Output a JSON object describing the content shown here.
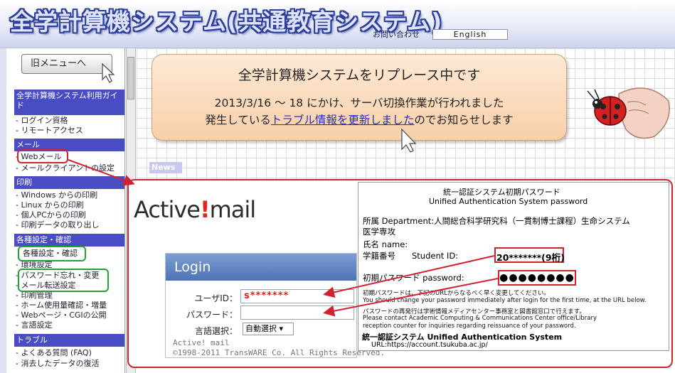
{
  "header": {
    "title": "全学計算機システム(共通教育システム)",
    "contact": "お問い合わせ",
    "english": "English"
  },
  "sidebar": {
    "old_menu": "旧メニューへ",
    "sections": [
      {
        "title": "全学計算機システム利用ガイド",
        "items": [
          "ログイン資格",
          "リモートアクセス"
        ]
      },
      {
        "title": "メール",
        "items": [
          "Webメール",
          "メールクライアントの設定"
        ]
      },
      {
        "title": "印刷",
        "items": [
          "Windows からの印刷",
          "Linux からの印刷",
          "個人PCからの印刷",
          "印刷データの取り出し"
        ]
      },
      {
        "title": "各種設定・確認",
        "items": [
          "各種設定・確認",
          "環境設定",
          "パスワード忘れ・変更",
          "メール転送設定",
          "印刷管理",
          "ホーム使用量確認・増量",
          "Webページ・CGIの公開",
          "言語設定"
        ]
      },
      {
        "title": "トラブル",
        "items": [
          "よくある質問 (FAQ)",
          "消去したデータの復活"
        ]
      }
    ]
  },
  "announcement": {
    "title": "全学計算機システムをリプレース中です",
    "line1": "2013/3/16 ～ 18 にかけ、サーバ切換作業が行われました",
    "line2_prefix": "発生している",
    "line2_link": "トラブル情報を更新しました",
    "line2_suffix": "のでお知らせします"
  },
  "news": {
    "tab": "News"
  },
  "activemail": {
    "logo_before": "Active",
    "logo_mark": "!",
    "logo_after": "mail",
    "login_title": "Login",
    "userid_label": "ユーザID：",
    "userid_value": "s*******",
    "password_label": "パスワード：",
    "lang_label": "言語選択：",
    "lang_value": "自動選択",
    "copyright1": "Active! mail",
    "copyright2": "©1998-2011 TransWARE Co. All Rights Reserved."
  },
  "info_card": {
    "title": "統一認証システム初期パスワード",
    "subtitle": "Unified Authentication System password",
    "dept_line1": "所属 Department:人間総合科学研究科（一貫制博士課程）生命システム",
    "dept_line2": "医学専攻",
    "name_line": "氏名 name:",
    "sid_line": "学籍番号　　Student ID:",
    "sid_value": "20*******(9桁)",
    "pw_line": "初期パスワード password:",
    "pw_dots": "●●●●●●●●",
    "note1": "初期パスワードは、下記のURLからなるべく早く変更してください。",
    "note2": "You should change your password immediately after login for the first time, at the URL below.",
    "note3": "パスワードの再発行は学術情報メディアセンター事務室と図書館窓口で行えます。",
    "note4": "Please contact Academic Computing & Communications Center office/Library",
    "note5": "reception counter for inquiries regarding reissuance of your password.",
    "system_label": "統一認証システム Unified Authentication System",
    "system_url": "URL:https://account.tsukuba.ac.jp/"
  },
  "colors": {
    "accent_red": "#d12230",
    "accent_green": "#23a23a",
    "nav_blue": "#4a4cc4"
  }
}
